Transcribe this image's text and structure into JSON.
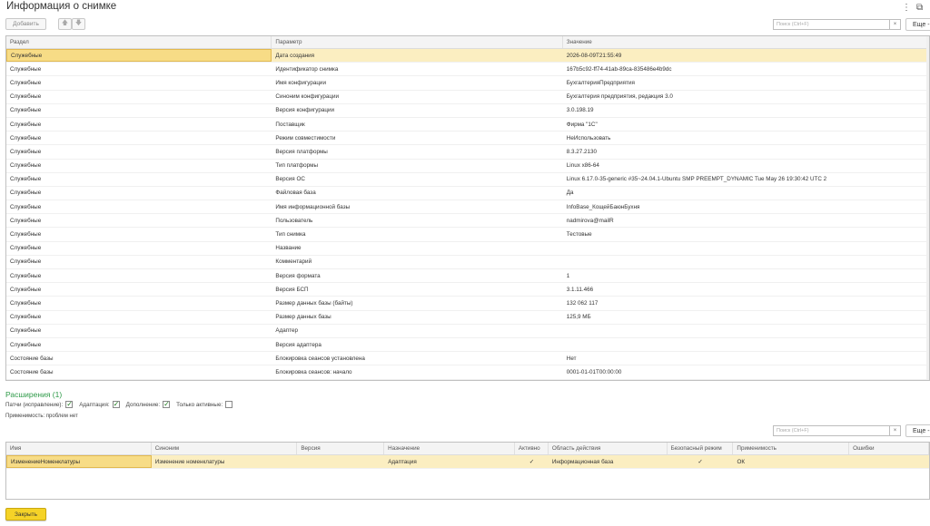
{
  "window": {
    "title": "Информация о снимке",
    "menu_icon": "⋮",
    "restore_icon": "⧉"
  },
  "toolbar": {
    "add_label": "Добавить",
    "up_icon": "🡅",
    "down_icon": "🡇",
    "search_placeholder": "Поиск (Ctrl+F)",
    "clear_icon": "×",
    "more_label": "Еще -"
  },
  "main_table": {
    "columns": [
      "Раздел",
      "Параметр",
      "Значение"
    ],
    "rows": [
      [
        "Служебные",
        "Дата создания",
        "2026-08-09T21:55:49"
      ],
      [
        "Служебные",
        "Идентификатор снимка",
        "167b5c92-ff74-41ab-89ca-835486e4b9dc"
      ],
      [
        "Служебные",
        "Имя конфигурации",
        "БухгалтерияПредприятия"
      ],
      [
        "Служебные",
        "Синоним конфигурации",
        "Бухгалтерия предприятия, редакция 3.0"
      ],
      [
        "Служебные",
        "Версия конфигурации",
        "3.0.198.19"
      ],
      [
        "Служебные",
        "Поставщик",
        "Фирма \"1С\""
      ],
      [
        "Служебные",
        "Режим совместимости",
        "НеИспользовать"
      ],
      [
        "Служебные",
        "Версия платформы",
        "8.3.27.2130"
      ],
      [
        "Служебные",
        "Тип платформы",
        "Linux x86-64"
      ],
      [
        "Служебные",
        "Версия ОС",
        "Linux 6.17.0-35-generic #35~24.04.1-Ubuntu SMP PREEMPT_DYNAMIC Tue May 26 19:30:42 UTC 2"
      ],
      [
        "Служебные",
        "Файловая база",
        "Да"
      ],
      [
        "Служебные",
        "Имя информационной базы",
        "InfoBase_КощейБаюнБухня"
      ],
      [
        "Служебные",
        "Пользователь",
        "nadmirova@mailR"
      ],
      [
        "Служебные",
        "Тип снимка",
        "Тестовые"
      ],
      [
        "Служебные",
        "Название",
        ""
      ],
      [
        "Служебные",
        "Комментарий",
        ""
      ],
      [
        "Служебные",
        "Версия формата",
        "1"
      ],
      [
        "Служебные",
        "Версия БСП",
        "3.1.11.466"
      ],
      [
        "Служебные",
        "Размер данных базы (байты)",
        "132 062 117"
      ],
      [
        "Служебные",
        "Размер данных базы",
        "125,9 МБ"
      ],
      [
        "Служебные",
        "Адаптер",
        ""
      ],
      [
        "Служебные",
        "Версия адаптера",
        ""
      ],
      [
        "Состояние базы",
        "Блокировка сеансов установлена",
        "Нет"
      ],
      [
        "Состояние базы",
        "Блокировка сеансов: начало",
        "0001-01-01T00:00:00"
      ]
    ]
  },
  "extensions": {
    "title": "Расширения (1)",
    "filters": [
      {
        "label": "Патчи (исправление):",
        "checked": true
      },
      {
        "label": "Адаптация:",
        "checked": true
      },
      {
        "label": "Дополнение:",
        "checked": true
      },
      {
        "label": "Только активные:",
        "checked": false
      }
    ],
    "applicability_note": "Применимость: проблем нет",
    "search_placeholder": "Поиск (Ctrl+F)",
    "clear_icon": "×",
    "more_label": "Еще -",
    "columns": [
      "Имя",
      "Синоним",
      "Версия",
      "Назначение",
      "Активно",
      "Область действия",
      "Безопасный режим",
      "Применимость",
      "Ошибки"
    ],
    "rows": [
      {
        "name": "ИзменениеНоменклатуры",
        "synonym": "Изменение номенклатуры",
        "version": "",
        "purpose": "Адаптация",
        "active": "✓",
        "scope": "Информационная база",
        "safe_mode": "✓",
        "applicability": "ОК",
        "errors": ""
      }
    ]
  },
  "footer": {
    "close_label": "Закрыть"
  }
}
